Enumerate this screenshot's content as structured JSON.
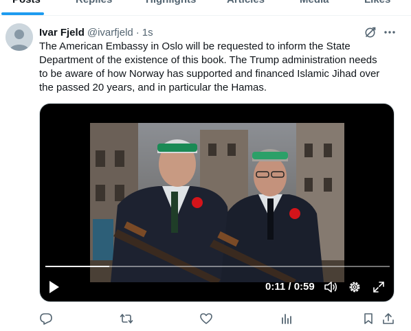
{
  "tabs": [
    {
      "label": "Posts",
      "active": true
    },
    {
      "label": "Replies",
      "active": false
    },
    {
      "label": "Highlights",
      "active": false
    },
    {
      "label": "Articles",
      "active": false
    },
    {
      "label": "Media",
      "active": false
    },
    {
      "label": "Likes",
      "active": false
    }
  ],
  "tweet": {
    "author_name": "Ivar Fjeld",
    "author_handle": "@ivarfjeld",
    "separator": "·",
    "timestamp": "1s",
    "text_lines": [
      "The American Embassy in Oslo will be requested to inform the State",
      "Department of the existence of this book.  The Trump administration needs",
      "to be aware of how Norway has supported and financed Islamic Jihad over",
      "the passed 20 years, and in particular the Hamas."
    ]
  },
  "video": {
    "current_time": "0:11",
    "separator": "/",
    "duration": "0:59",
    "progress_fraction": 0.186
  },
  "icons": {
    "grok": "grok-icon",
    "more": "more-icon",
    "play": "play-icon",
    "volume": "volume-icon",
    "settings": "gear-icon",
    "fullscreen": "fullscreen-icon",
    "reply": "reply-icon",
    "repost": "repost-icon",
    "like": "heart-icon",
    "views": "analytics-icon",
    "bookmark": "bookmark-icon",
    "share": "share-icon"
  },
  "colors": {
    "accent": "#1d9bf0",
    "text_primary": "#0f1419",
    "text_secondary": "#536471"
  }
}
